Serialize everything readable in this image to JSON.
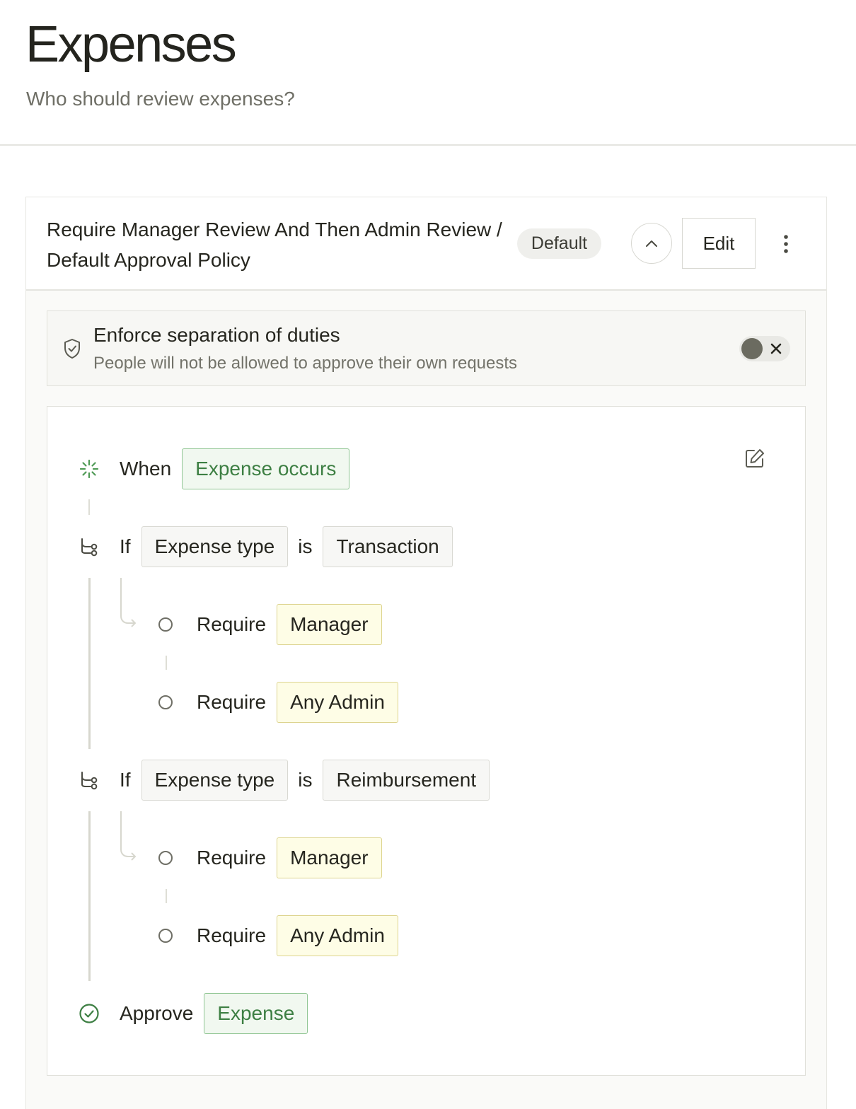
{
  "page": {
    "title": "Expenses",
    "subtitle": "Who should review expenses?"
  },
  "policy": {
    "name": "Require Manager Review And Then Admin Review / Default Approval Policy",
    "badge": "Default",
    "edit_label": "Edit",
    "icons": {
      "collapse": "chevron-up-icon",
      "more": "more-vertical-icon",
      "edit_rules": "edit-icon"
    }
  },
  "separation_of_duties": {
    "title": "Enforce separation of duties",
    "description": "People will not be allowed to approve their own requests",
    "enabled": false,
    "icon": "shield-check-icon"
  },
  "flow": {
    "trigger": {
      "keyword": "When",
      "event": "Expense occurs"
    },
    "conditions": [
      {
        "keyword": "If",
        "field": "Expense type",
        "operator": "is",
        "value": "Transaction",
        "steps": [
          {
            "keyword": "Require",
            "approver": "Manager"
          },
          {
            "keyword": "Require",
            "approver": "Any Admin"
          }
        ]
      },
      {
        "keyword": "If",
        "field": "Expense type",
        "operator": "is",
        "value": "Reimbursement",
        "steps": [
          {
            "keyword": "Require",
            "approver": "Manager"
          },
          {
            "keyword": "Require",
            "approver": "Any Admin"
          }
        ]
      }
    ],
    "outcome": {
      "keyword": "Approve",
      "object": "Expense"
    }
  },
  "colors": {
    "accent_green": "#3d7f43",
    "approver_yellow": "#fefde6",
    "toggle_off": "#6b6b60"
  }
}
